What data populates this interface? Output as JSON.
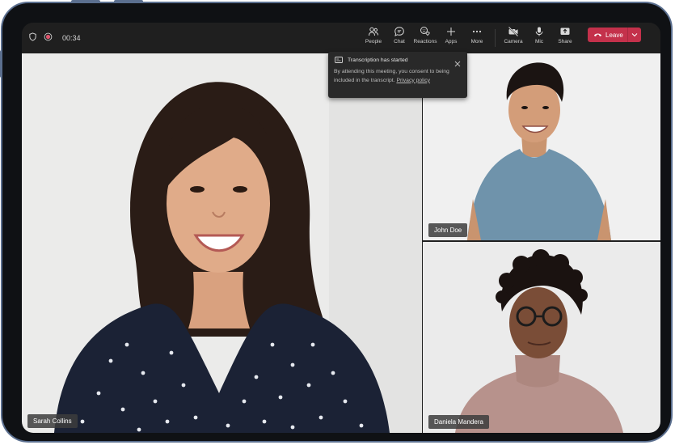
{
  "call": {
    "timer": "00:34"
  },
  "toolbar": {
    "actions": [
      {
        "label": "People",
        "icon": "people-icon"
      },
      {
        "label": "Chat",
        "icon": "chat-icon"
      },
      {
        "label": "Reactions",
        "icon": "reactions-icon"
      },
      {
        "label": "Apps",
        "icon": "plus-icon"
      },
      {
        "label": "More",
        "icon": "more-icon"
      }
    ],
    "media": [
      {
        "label": "Camera",
        "icon": "camera-off-icon"
      },
      {
        "label": "Mic",
        "icon": "mic-icon"
      },
      {
        "label": "Share",
        "icon": "share-icon"
      }
    ],
    "leave_label": "Leave"
  },
  "participants": [
    {
      "name": "Sarah Collins"
    },
    {
      "name": "John Doe"
    },
    {
      "name": "Daniela Mandera"
    }
  ],
  "toast": {
    "title": "Transcription has started",
    "body": "By attending this meeting, you consent to being included in the transcript.",
    "link": "Privacy policy"
  },
  "colors": {
    "leave": "#c4314b",
    "frame": "#5b6f8f",
    "background": "#1f1f1f"
  }
}
